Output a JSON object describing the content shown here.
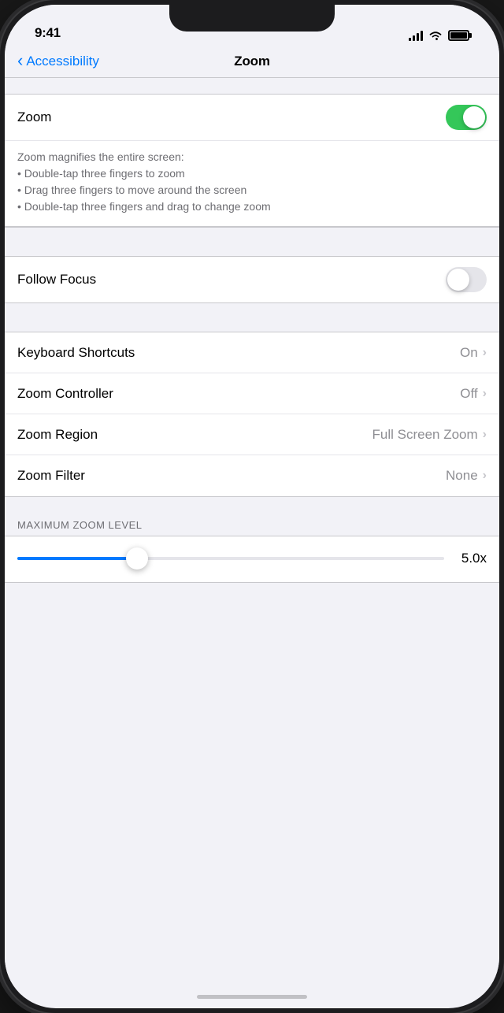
{
  "statusBar": {
    "time": "9:41"
  },
  "navBar": {
    "backLabel": "Accessibility",
    "title": "Zoom"
  },
  "sections": {
    "zoom": {
      "label": "Zoom",
      "toggleState": "on",
      "description": "Zoom magnifies the entire screen:\n• Double-tap three fingers to zoom\n• Drag three fingers to move around the screen\n• Double-tap three fingers and drag to change zoom"
    },
    "followFocus": {
      "label": "Follow Focus",
      "toggleState": "off"
    },
    "keyboardShortcuts": {
      "label": "Keyboard Shortcuts",
      "value": "On"
    },
    "zoomController": {
      "label": "Zoom Controller",
      "value": "Off"
    },
    "zoomRegion": {
      "label": "Zoom Region",
      "value": "Full Screen Zoom"
    },
    "zoomFilter": {
      "label": "Zoom Filter",
      "value": "None"
    },
    "maxZoomLevel": {
      "sectionLabel": "MAXIMUM ZOOM LEVEL",
      "value": "5.0x",
      "sliderPercent": 28
    }
  }
}
